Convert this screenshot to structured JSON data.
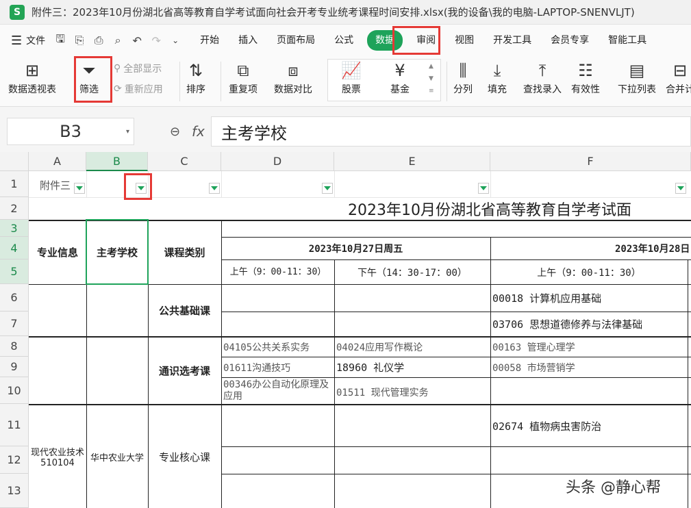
{
  "app": {
    "title": "附件三：2023年10月份湖北省高等教育自学考试面向社会开考专业统考课程时间安排.xlsx(我的设备\\我的电脑-LAPTOP-SNENVLJT)",
    "icon_letter": "S"
  },
  "menu": {
    "file_label": "文件",
    "tabs": [
      "开始",
      "插入",
      "页面布局",
      "公式",
      "数据",
      "审阅",
      "视图",
      "开发工具",
      "会员专享",
      "智能工具"
    ],
    "active_tab": "数据"
  },
  "ribbon": {
    "pivot": "数据透视表",
    "filter": "筛选",
    "show_all": "全部显示",
    "reapply": "重新应用",
    "sort": "排序",
    "duplicates": "重复项",
    "compare": "数据对比",
    "stocks": "股票",
    "funds": "基金",
    "split": "分列",
    "fill": "填充",
    "lookup": "查找录入",
    "validity": "有效性",
    "dropdown_list": "下拉列表",
    "merge_calc": "合并计"
  },
  "formula": {
    "name_box": "B3",
    "fx": "fx",
    "content": "主考学校"
  },
  "columns": [
    "A",
    "B",
    "C",
    "D",
    "E",
    "F"
  ],
  "rows": [
    "1",
    "2",
    "3",
    "4",
    "5",
    "6",
    "7",
    "8",
    "9",
    "10",
    "11",
    "12",
    "13"
  ],
  "sheet": {
    "a1": "附件三",
    "title": "2023年10月份湖北省高等教育自学考试面",
    "h_major": "专业信息",
    "h_school": "主考学校",
    "h_category": "课程类别",
    "date1": "2023年10月27日周五",
    "date2": "2023年10月28日",
    "am1": "上午（9：00-11：30）",
    "pm1": "下午（14：30-17：00）",
    "am2": "上午（9：00-11：30）",
    "cat_public": "公共基础课",
    "cat_general": "通识选考课",
    "cat_core": "专业核心课",
    "f6": "00018 计算机应用基础",
    "f7": "03706 思想道德修养与法律基础",
    "d8": "04105公共关系实务",
    "e8": "04024应用写作概论",
    "f8": "00163 管理心理学",
    "d9": "01611沟通技巧",
    "e9": "18960 礼仪学",
    "f9": "00058 市场营销学",
    "d10": "00346办公自动化原理及应用",
    "e10": "01511 现代管理实务",
    "f11": "02674 植物病虫害防治",
    "major": "现代农业技术510104",
    "school": "华中农业大学"
  },
  "watermark": "头条 @静心帮",
  "colors": {
    "accent": "#1ea35a",
    "highlight": "#e53935"
  }
}
